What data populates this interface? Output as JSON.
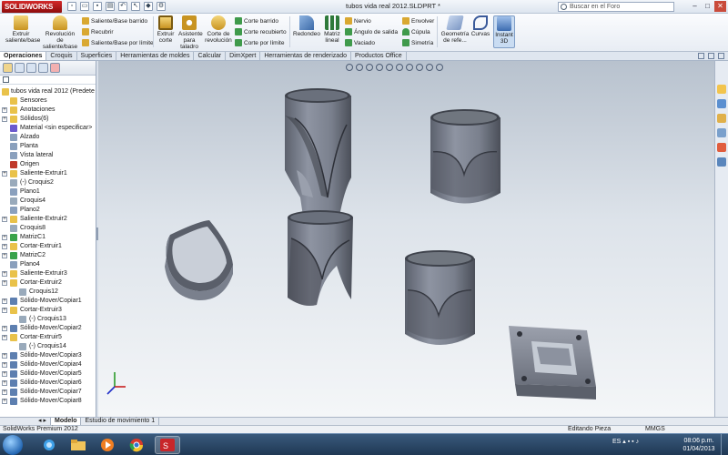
{
  "app": {
    "logo": "SOLIDWORKS",
    "window_title": "tubos vida real 2012.SLDPRT *",
    "search_placeholder": "Buscar en el Foro",
    "window_buttons": [
      "–",
      "□",
      "✕"
    ]
  },
  "command_manager": {
    "extruir_saliente": "Extruir saliente/base",
    "revolucion_saliente": "Revolución de saliente/base",
    "saliente_barrido": "Saliente/Base barrido",
    "recubrir": "Recubrir",
    "saliente_limite": "Saliente/Base por límite",
    "extruir_corte": "Extruir corte",
    "asistente_taladro": "Asistente para taladro",
    "corte_revolucion": "Corte de revolución",
    "corte_barrido": "Corte barrido",
    "corte_recubierto": "Corte recubierto",
    "corte_limite": "Corte por límite",
    "redondeo": "Redondeo",
    "matriz_lineal": "Matriz lineal",
    "nervio": "Nervio",
    "angulo_salida": "Ángulo de salida",
    "vaciado": "Vaciado",
    "envolver": "Envolver",
    "cupula": "Cúpula",
    "simetria": "Simetría",
    "geometria_referencia": "Geometría de refe...",
    "curvas": "Curvas",
    "instant3d": "Instant 3D"
  },
  "tabs": [
    "Operaciones",
    "Croquis",
    "Superficies",
    "Herramientas de moldes",
    "Calcular",
    "DimXpert",
    "Herramientas de renderizado",
    "Productos Office"
  ],
  "feature_tree": {
    "root": "tubos vida real 2012  (Predete",
    "items": [
      {
        "label": "Sensores",
        "indent": 1,
        "expand": false,
        "color": "#e9c24a"
      },
      {
        "label": "Anotaciones",
        "indent": 1,
        "expand": true,
        "color": "#e9c24a"
      },
      {
        "label": "Sólidos(6)",
        "indent": 1,
        "expand": true,
        "color": "#e9c24a"
      },
      {
        "label": "Material <sin especificar>",
        "indent": 1,
        "expand": false,
        "color": "#6a5acd"
      },
      {
        "label": "Alzado",
        "indent": 1,
        "expand": false,
        "color": "#8aa0bd"
      },
      {
        "label": "Planta",
        "indent": 1,
        "expand": false,
        "color": "#8aa0bd"
      },
      {
        "label": "Vista lateral",
        "indent": 1,
        "expand": false,
        "color": "#8aa0bd"
      },
      {
        "label": "Origen",
        "indent": 1,
        "expand": false,
        "color": "#c0392b"
      },
      {
        "label": "Saliente-Extruir1",
        "indent": 1,
        "expand": true,
        "color": "#e9c24a"
      },
      {
        "label": "(-) Croquis2",
        "indent": 1,
        "expand": false,
        "color": "#9ab"
      },
      {
        "label": "Plano1",
        "indent": 1,
        "expand": false,
        "color": "#8aa0bd"
      },
      {
        "label": "Croquis4",
        "indent": 1,
        "expand": false,
        "color": "#9ab"
      },
      {
        "label": "Plano2",
        "indent": 1,
        "expand": false,
        "color": "#8aa0bd"
      },
      {
        "label": "Saliente-Extruir2",
        "indent": 1,
        "expand": true,
        "color": "#e9c24a"
      },
      {
        "label": "Croquis8",
        "indent": 1,
        "expand": false,
        "color": "#9ab"
      },
      {
        "label": "MatrizC1",
        "indent": 1,
        "expand": true,
        "color": "#3aa34a"
      },
      {
        "label": "Cortar-Extruir1",
        "indent": 1,
        "expand": true,
        "color": "#e9c24a"
      },
      {
        "label": "MatrizC2",
        "indent": 1,
        "expand": true,
        "color": "#3aa34a"
      },
      {
        "label": "Plano4",
        "indent": 1,
        "expand": false,
        "color": "#8aa0bd"
      },
      {
        "label": "Saliente-Extruir3",
        "indent": 1,
        "expand": true,
        "color": "#e9c24a"
      },
      {
        "label": "Cortar-Extruir2",
        "indent": 1,
        "expand": true,
        "color": "#e9c24a"
      },
      {
        "label": "Croquis12",
        "indent": 2,
        "expand": false,
        "color": "#9ab"
      },
      {
        "label": "Sólido-Mover/Copiar1",
        "indent": 1,
        "expand": true,
        "color": "#5d7fb0"
      },
      {
        "label": "Cortar-Extruir3",
        "indent": 1,
        "expand": true,
        "color": "#e9c24a"
      },
      {
        "label": "(-) Croquis13",
        "indent": 2,
        "expand": false,
        "color": "#9ab"
      },
      {
        "label": "Sólido-Mover/Copiar2",
        "indent": 1,
        "expand": true,
        "color": "#5d7fb0"
      },
      {
        "label": "Cortar-Extruir5",
        "indent": 1,
        "expand": true,
        "color": "#e9c24a"
      },
      {
        "label": "(-) Croquis14",
        "indent": 2,
        "expand": false,
        "color": "#9ab"
      },
      {
        "label": "Sólido-Mover/Copiar3",
        "indent": 1,
        "expand": true,
        "color": "#5d7fb0"
      },
      {
        "label": "Sólido-Mover/Copiar4",
        "indent": 1,
        "expand": true,
        "color": "#5d7fb0"
      },
      {
        "label": "Sólido-Mover/Copiar5",
        "indent": 1,
        "expand": true,
        "color": "#5d7fb0"
      },
      {
        "label": "Sólido-Mover/Copiar6",
        "indent": 1,
        "expand": true,
        "color": "#5d7fb0"
      },
      {
        "label": "Sólido-Mover/Copiar7",
        "indent": 1,
        "expand": true,
        "color": "#5d7fb0"
      },
      {
        "label": "Sólido-Mover/Copiar8",
        "indent": 1,
        "expand": true,
        "color": "#5d7fb0"
      }
    ]
  },
  "bottom_tabs": [
    "Modelo",
    "Estudio de movimiento 1"
  ],
  "status": {
    "product": "SolidWorks Premium 2012",
    "mode": "Editando Pieza",
    "units": "MMGS"
  },
  "taskbar": {
    "lang": "ES",
    "time": "08:06 p.m.",
    "date": "01/04/2013"
  },
  "colors": {
    "model_fill": "#7c8290",
    "model_dark": "#50545e",
    "viewport_top": "#b8c2ce"
  }
}
